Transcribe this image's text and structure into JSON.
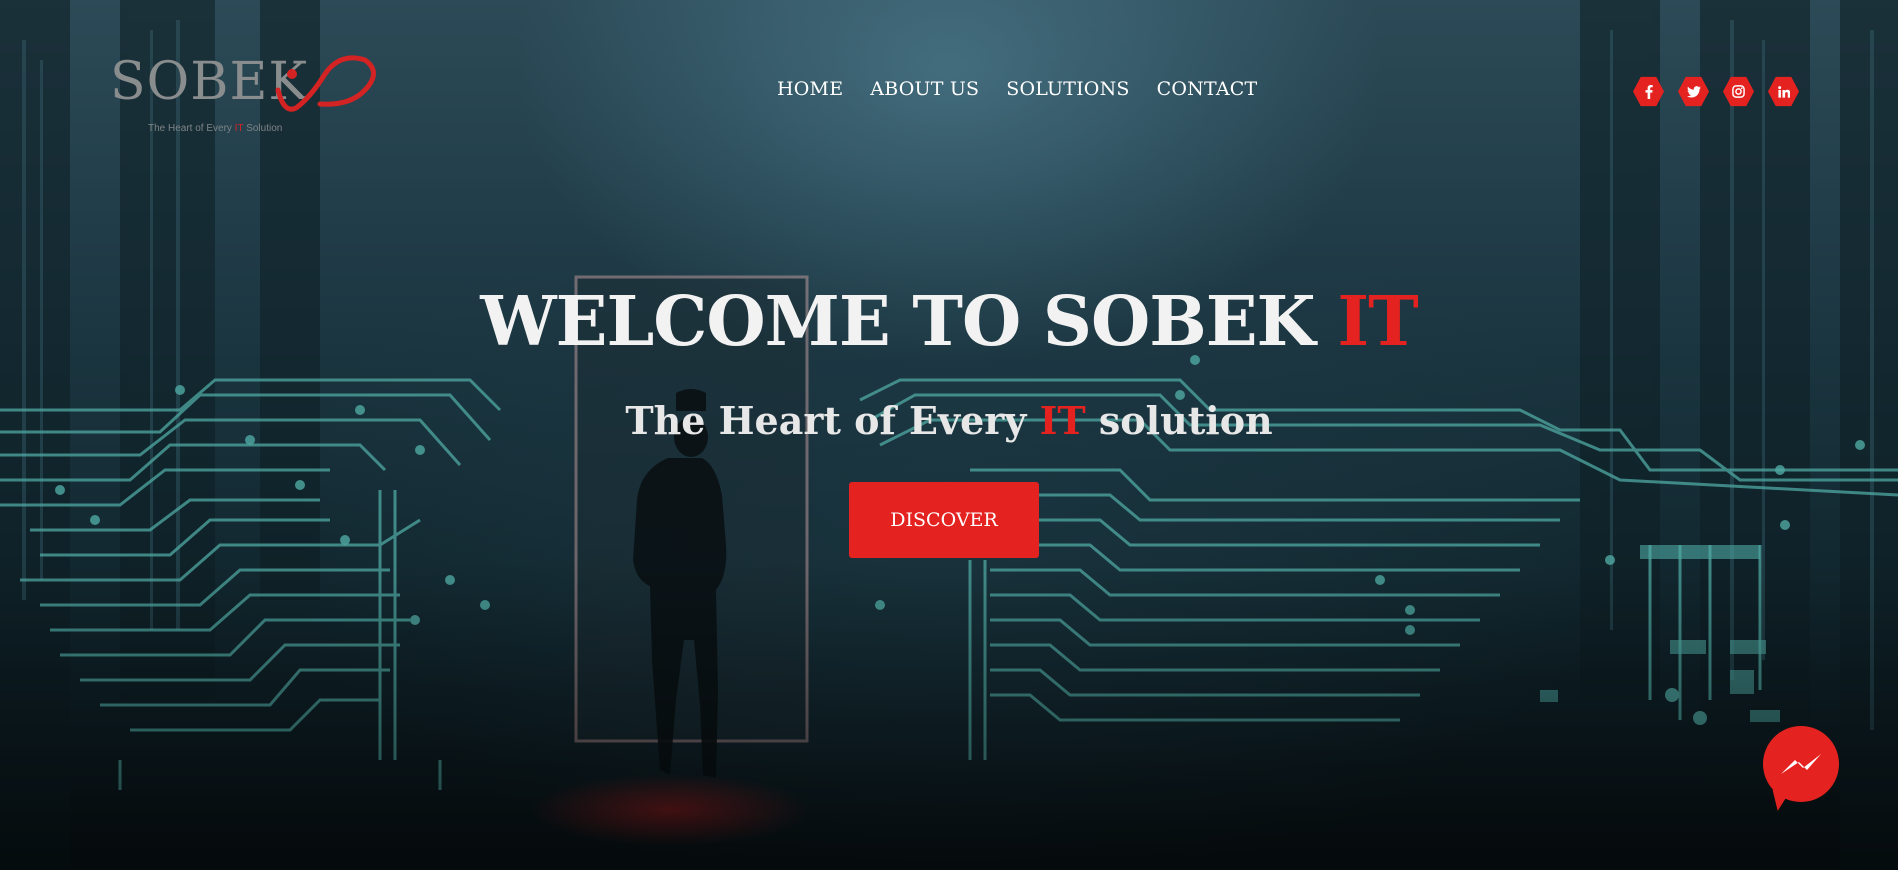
{
  "brand": {
    "logo_text": "SOBEK",
    "tagline_pre": "The Heart of Every ",
    "tagline_accent": "IT",
    "tagline_post": " Solution",
    "accent_color": "#e42320"
  },
  "nav": {
    "items": [
      {
        "label": "HOME"
      },
      {
        "label": "ABOUT US"
      },
      {
        "label": "SOLUTIONS"
      },
      {
        "label": "CONTACT"
      }
    ]
  },
  "social": {
    "icons": [
      "facebook-icon",
      "twitter-icon",
      "instagram-icon",
      "linkedin-icon"
    ]
  },
  "hero": {
    "title_main": "WELCOME TO SOBEK ",
    "title_accent": "IT",
    "subtitle_pre": "The Heart of Every",
    "subtitle_accent": "IT",
    "subtitle_post": "solution",
    "cta_label": "DISCOVER"
  },
  "chat": {
    "icon": "messenger-icon"
  }
}
